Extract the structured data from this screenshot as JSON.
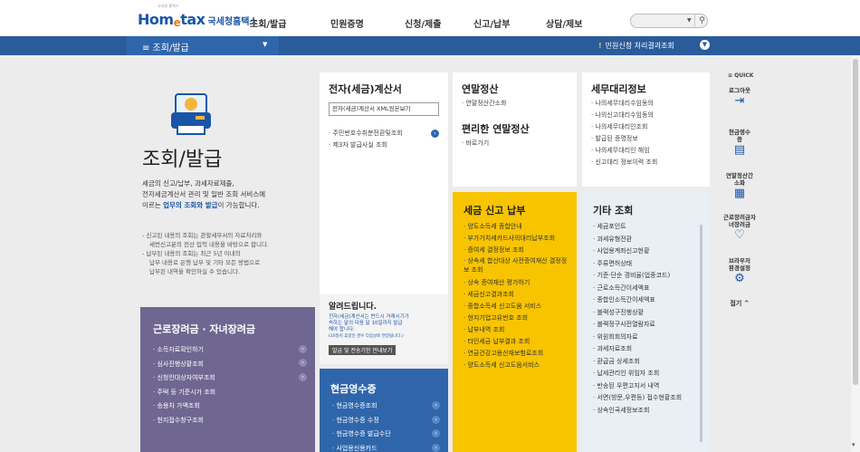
{
  "header": {
    "logo_text_home": "Hom",
    "logo_text_e": "e",
    "logo_text_tax": "tax",
    "logo_korean": "국세청홈택스",
    "logo_tag": "국세청 홈택스",
    "nav": [
      "조회/발급",
      "민원증명",
      "신청/제출",
      "신고/납부",
      "상담/제보"
    ],
    "search_placeholder": ""
  },
  "bar": {
    "menu_label": "≡ 조회/발급",
    "civil_result": "민원신청 처리결과조회"
  },
  "intro": {
    "title": "조회/발급",
    "desc_line1": "세금의 신고/납부, 과세자료제출,",
    "desc_line2": "전자세금계산서 관리 및 일반 조회 서비스에",
    "desc_line3_pre": "이르는 ",
    "desc_line3_bold": "업무의 조회와 발급",
    "desc_line3_post": "이 가능합니다.",
    "note1": "- 신고된 내용의 조회는 관할세무서의 자료처리와",
    "note1b": "세번신고분의 전산 입력 내용을 바탕으로 합니다.",
    "note2": "- 납부된 내용의 조회는 최근 5년 이내의",
    "note2b": "납부 내용로 은행 납부 및 기타 모든 방법으로",
    "note2c": "납부된 내역을 확인하실 수 있습니다."
  },
  "etax": {
    "title": "전자(세금)계산서",
    "box_label": "전자(세금)계산서 XML원본보기",
    "items": [
      "주민번호수취분전환및조회",
      "제3자 발급사실 조회"
    ],
    "notice_title": "알려드립니다.",
    "notice_line1": "전자(세금)계산서는 반드시 거래시기가",
    "notice_line2": "속하는 달의 다음 달 10일까지 발급",
    "notice_line3": "해야 합니다.",
    "notice_small": "(10일이 휴일인 경우 다음날로 연장됩니다.)",
    "notice_button": "발급 및 전송기한 안내보기"
  },
  "yearend": {
    "title": "연말정산",
    "items": [
      "연말정산간소화"
    ],
    "title2": "편리한 연말정산",
    "items2": [
      "바로가기"
    ]
  },
  "agent": {
    "title": "세무대리정보",
    "items": [
      "나의세무대리수임동의",
      "나의신고대리수임동의",
      "나의세무대리인조회",
      "발급된 증명정보",
      "나의세무대리인 해임",
      "신고대리 정보이력 조회"
    ]
  },
  "tax_pay": {
    "title": "세금 신고 납부",
    "items": [
      "양도소득세 종합안내",
      "부가가치세카드사의대리납부조회",
      "증여세 결정정보 조회",
      "상속세 합산대상 사전증여재산 결정정보 조회",
      "상속 증여재산 평가하기",
      "세금신고결과조회",
      "종합소득세 신고도움 서비스",
      "현지기업고유번호 조회",
      "납부내역 조회",
      "타인세금 납부결과 조회",
      "연금건강고용산재보험료조회",
      "양도소득세 신고도움서비스"
    ]
  },
  "etc": {
    "title": "기타 조회",
    "items": [
      "세금포인트",
      "과세유형전환",
      "사업용계좌신고현황",
      "주류면허상태",
      "기준·단순 경비율(업종코드)",
      "근로소득간이세액표",
      "종합인소득간이세액표",
      "블랙성구진행상황",
      "블랙정구사전열람자료",
      "위원회회의자료",
      "과세자료조회",
      "환급금 상세조회",
      "납세관리인 위임자 조회",
      "반송된 우편고지서 내역",
      "서면(방문,우편등) 접수현황조회",
      "상속인국세정보조회"
    ]
  },
  "labor": {
    "title": "근로장려금 · 자녀장려금",
    "items": [
      "소득자료확인하기",
      "심사진행상황조회",
      "신청인대상자여부조회",
      "주택 등 기준시가 조회",
      "송용차 가액조회",
      "현지접수창구조회"
    ]
  },
  "cash": {
    "title": "현금영수증",
    "items": [
      "현금영수증조회",
      "현금영수증 수정",
      "현금영수증 발급수단",
      "사업용신용카드"
    ]
  },
  "quick": {
    "title": "≡ QUICK",
    "items": [
      {
        "label": "로그아웃",
        "icon": "logout-icon"
      },
      {
        "label": "현금영수증",
        "icon": "receipt-icon"
      },
      {
        "label": "연말정산간소화",
        "icon": "yearend-icon"
      },
      {
        "label": "근로장려금자녀장려금",
        "icon": "heart-icon"
      },
      {
        "label": "브라우저환경설정",
        "icon": "gear-icon"
      }
    ],
    "close": "접기 ^"
  },
  "colors": {
    "brand": "#1a56a8",
    "bar": "#2a5b9a",
    "yellow": "#f8c400",
    "purple": "#6f6791"
  }
}
